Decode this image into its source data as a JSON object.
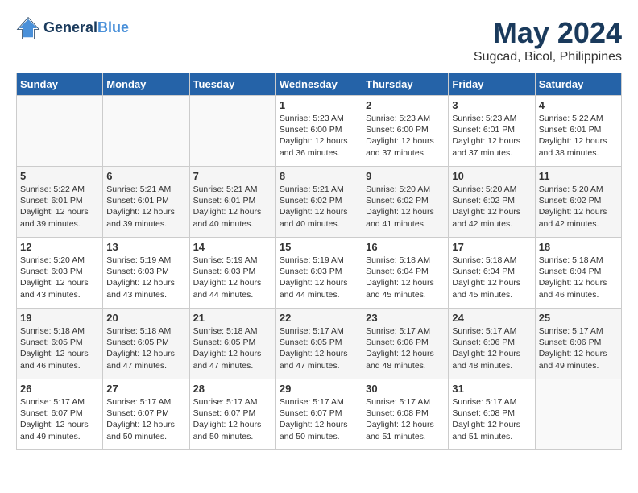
{
  "header": {
    "logo_line1": "General",
    "logo_line2": "Blue",
    "month": "May 2024",
    "location": "Sugcad, Bicol, Philippines"
  },
  "days_of_week": [
    "Sunday",
    "Monday",
    "Tuesday",
    "Wednesday",
    "Thursday",
    "Friday",
    "Saturday"
  ],
  "weeks": [
    [
      {
        "day": "",
        "sunrise": "",
        "sunset": "",
        "daylight": ""
      },
      {
        "day": "",
        "sunrise": "",
        "sunset": "",
        "daylight": ""
      },
      {
        "day": "",
        "sunrise": "",
        "sunset": "",
        "daylight": ""
      },
      {
        "day": "1",
        "sunrise": "Sunrise: 5:23 AM",
        "sunset": "Sunset: 6:00 PM",
        "daylight": "Daylight: 12 hours and 36 minutes."
      },
      {
        "day": "2",
        "sunrise": "Sunrise: 5:23 AM",
        "sunset": "Sunset: 6:00 PM",
        "daylight": "Daylight: 12 hours and 37 minutes."
      },
      {
        "day": "3",
        "sunrise": "Sunrise: 5:23 AM",
        "sunset": "Sunset: 6:01 PM",
        "daylight": "Daylight: 12 hours and 37 minutes."
      },
      {
        "day": "4",
        "sunrise": "Sunrise: 5:22 AM",
        "sunset": "Sunset: 6:01 PM",
        "daylight": "Daylight: 12 hours and 38 minutes."
      }
    ],
    [
      {
        "day": "5",
        "sunrise": "Sunrise: 5:22 AM",
        "sunset": "Sunset: 6:01 PM",
        "daylight": "Daylight: 12 hours and 39 minutes."
      },
      {
        "day": "6",
        "sunrise": "Sunrise: 5:21 AM",
        "sunset": "Sunset: 6:01 PM",
        "daylight": "Daylight: 12 hours and 39 minutes."
      },
      {
        "day": "7",
        "sunrise": "Sunrise: 5:21 AM",
        "sunset": "Sunset: 6:01 PM",
        "daylight": "Daylight: 12 hours and 40 minutes."
      },
      {
        "day": "8",
        "sunrise": "Sunrise: 5:21 AM",
        "sunset": "Sunset: 6:02 PM",
        "daylight": "Daylight: 12 hours and 40 minutes."
      },
      {
        "day": "9",
        "sunrise": "Sunrise: 5:20 AM",
        "sunset": "Sunset: 6:02 PM",
        "daylight": "Daylight: 12 hours and 41 minutes."
      },
      {
        "day": "10",
        "sunrise": "Sunrise: 5:20 AM",
        "sunset": "Sunset: 6:02 PM",
        "daylight": "Daylight: 12 hours and 42 minutes."
      },
      {
        "day": "11",
        "sunrise": "Sunrise: 5:20 AM",
        "sunset": "Sunset: 6:02 PM",
        "daylight": "Daylight: 12 hours and 42 minutes."
      }
    ],
    [
      {
        "day": "12",
        "sunrise": "Sunrise: 5:20 AM",
        "sunset": "Sunset: 6:03 PM",
        "daylight": "Daylight: 12 hours and 43 minutes."
      },
      {
        "day": "13",
        "sunrise": "Sunrise: 5:19 AM",
        "sunset": "Sunset: 6:03 PM",
        "daylight": "Daylight: 12 hours and 43 minutes."
      },
      {
        "day": "14",
        "sunrise": "Sunrise: 5:19 AM",
        "sunset": "Sunset: 6:03 PM",
        "daylight": "Daylight: 12 hours and 44 minutes."
      },
      {
        "day": "15",
        "sunrise": "Sunrise: 5:19 AM",
        "sunset": "Sunset: 6:03 PM",
        "daylight": "Daylight: 12 hours and 44 minutes."
      },
      {
        "day": "16",
        "sunrise": "Sunrise: 5:18 AM",
        "sunset": "Sunset: 6:04 PM",
        "daylight": "Daylight: 12 hours and 45 minutes."
      },
      {
        "day": "17",
        "sunrise": "Sunrise: 5:18 AM",
        "sunset": "Sunset: 6:04 PM",
        "daylight": "Daylight: 12 hours and 45 minutes."
      },
      {
        "day": "18",
        "sunrise": "Sunrise: 5:18 AM",
        "sunset": "Sunset: 6:04 PM",
        "daylight": "Daylight: 12 hours and 46 minutes."
      }
    ],
    [
      {
        "day": "19",
        "sunrise": "Sunrise: 5:18 AM",
        "sunset": "Sunset: 6:05 PM",
        "daylight": "Daylight: 12 hours and 46 minutes."
      },
      {
        "day": "20",
        "sunrise": "Sunrise: 5:18 AM",
        "sunset": "Sunset: 6:05 PM",
        "daylight": "Daylight: 12 hours and 47 minutes."
      },
      {
        "day": "21",
        "sunrise": "Sunrise: 5:18 AM",
        "sunset": "Sunset: 6:05 PM",
        "daylight": "Daylight: 12 hours and 47 minutes."
      },
      {
        "day": "22",
        "sunrise": "Sunrise: 5:17 AM",
        "sunset": "Sunset: 6:05 PM",
        "daylight": "Daylight: 12 hours and 47 minutes."
      },
      {
        "day": "23",
        "sunrise": "Sunrise: 5:17 AM",
        "sunset": "Sunset: 6:06 PM",
        "daylight": "Daylight: 12 hours and 48 minutes."
      },
      {
        "day": "24",
        "sunrise": "Sunrise: 5:17 AM",
        "sunset": "Sunset: 6:06 PM",
        "daylight": "Daylight: 12 hours and 48 minutes."
      },
      {
        "day": "25",
        "sunrise": "Sunrise: 5:17 AM",
        "sunset": "Sunset: 6:06 PM",
        "daylight": "Daylight: 12 hours and 49 minutes."
      }
    ],
    [
      {
        "day": "26",
        "sunrise": "Sunrise: 5:17 AM",
        "sunset": "Sunset: 6:07 PM",
        "daylight": "Daylight: 12 hours and 49 minutes."
      },
      {
        "day": "27",
        "sunrise": "Sunrise: 5:17 AM",
        "sunset": "Sunset: 6:07 PM",
        "daylight": "Daylight: 12 hours and 50 minutes."
      },
      {
        "day": "28",
        "sunrise": "Sunrise: 5:17 AM",
        "sunset": "Sunset: 6:07 PM",
        "daylight": "Daylight: 12 hours and 50 minutes."
      },
      {
        "day": "29",
        "sunrise": "Sunrise: 5:17 AM",
        "sunset": "Sunset: 6:07 PM",
        "daylight": "Daylight: 12 hours and 50 minutes."
      },
      {
        "day": "30",
        "sunrise": "Sunrise: 5:17 AM",
        "sunset": "Sunset: 6:08 PM",
        "daylight": "Daylight: 12 hours and 51 minutes."
      },
      {
        "day": "31",
        "sunrise": "Sunrise: 5:17 AM",
        "sunset": "Sunset: 6:08 PM",
        "daylight": "Daylight: 12 hours and 51 minutes."
      },
      {
        "day": "",
        "sunrise": "",
        "sunset": "",
        "daylight": ""
      }
    ]
  ]
}
